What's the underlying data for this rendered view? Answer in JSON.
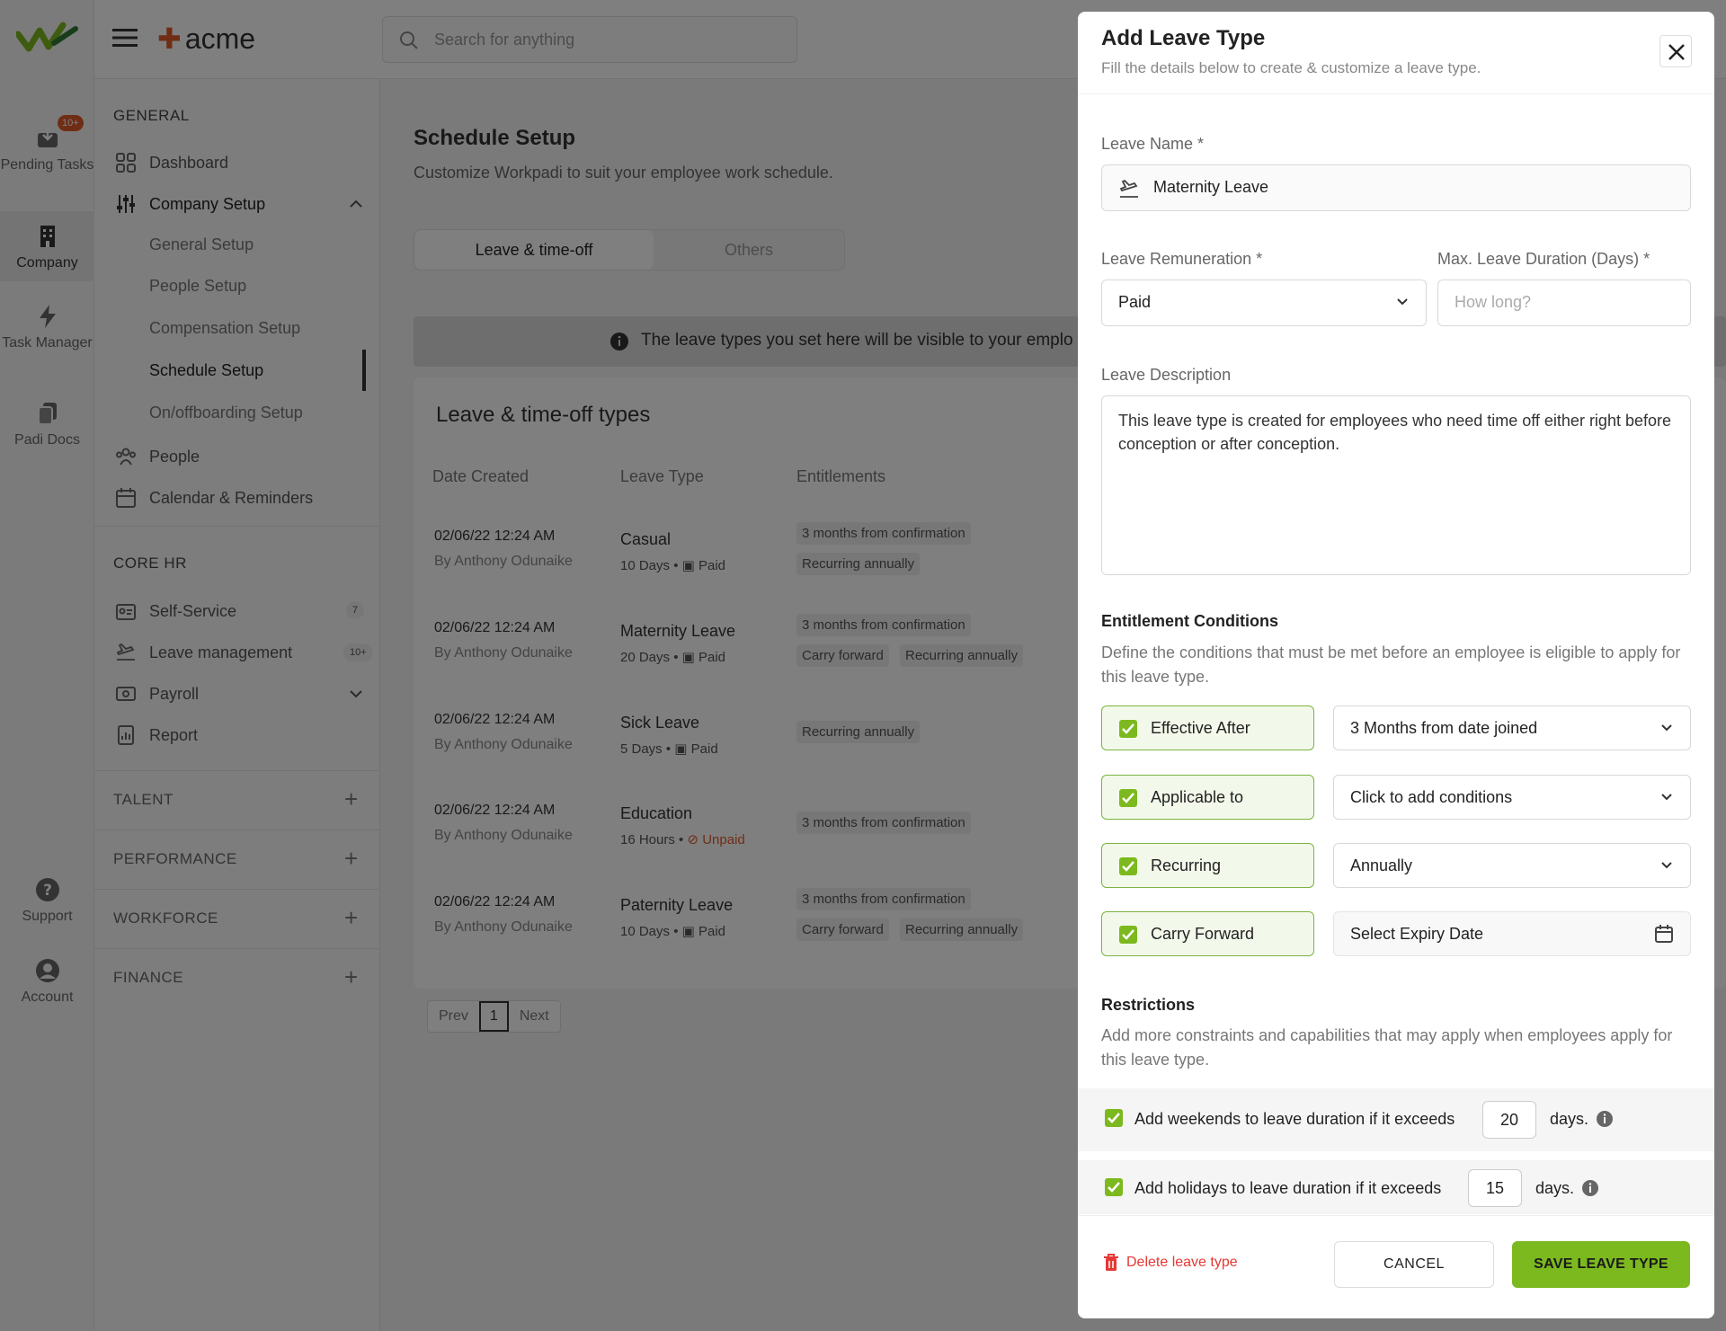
{
  "app": {
    "brand": "acme",
    "search_placeholder": "Search for anything"
  },
  "rail": {
    "pending_badge": "10+",
    "items": [
      {
        "label": "Pending Tasks"
      },
      {
        "label": "Company"
      },
      {
        "label": "Task Manager"
      },
      {
        "label": "Padi Docs"
      },
      {
        "label": "Support"
      },
      {
        "label": "Account"
      }
    ]
  },
  "sidebar": {
    "general_title": "GENERAL",
    "dashboard": "Dashboard",
    "company_setup": "Company Setup",
    "sub": [
      "General Setup",
      "People Setup",
      "Compensation Setup",
      "Schedule Setup",
      "On/offboarding Setup"
    ],
    "people": "People",
    "calendar": "Calendar & Reminders",
    "core_title": "CORE HR",
    "self_service": "Self-Service",
    "self_service_badge": "7",
    "leave_mgmt": "Leave management",
    "leave_badge": "10+",
    "payroll": "Payroll",
    "report": "Report",
    "groups": [
      "TALENT",
      "PERFORMANCE",
      "WORKFORCE",
      "FINANCE"
    ]
  },
  "main": {
    "title": "Schedule Setup",
    "subtitle": "Customize Workpadi to suit your employee work schedule.",
    "tabs": [
      "Leave & time-off",
      "Others"
    ],
    "banner": "The leave types you set here will be visible to your emplo",
    "card_title": "Leave & time-off types",
    "columns": [
      "Date Created",
      "Leave Type",
      "Entitlements"
    ],
    "rows": [
      {
        "date": "02/06/22 12:24 AM",
        "by": "By Anthony Odunaike",
        "type": "Casual",
        "meta_a": "10 Days •",
        "meta_b": "Paid",
        "chips": [
          "3 months from confirmation",
          "Recurring annually"
        ]
      },
      {
        "date": "02/06/22 12:24 AM",
        "by": "By Anthony Odunaike",
        "type": "Maternity Leave",
        "meta_a": "20 Days •",
        "meta_b": "Paid",
        "chips": [
          "3 months from confirmation",
          "Carry forward",
          "Recurring annually"
        ]
      },
      {
        "date": "02/06/22 12:24 AM",
        "by": "By Anthony Odunaike",
        "type": "Sick Leave",
        "meta_a": "5 Days •",
        "meta_b": "Paid",
        "chips": [
          "Recurring annually"
        ]
      },
      {
        "date": "02/06/22 12:24 AM",
        "by": "By Anthony Odunaike",
        "type": "Education",
        "meta_a": "16 Hours •",
        "meta_b": "Unpaid",
        "chips": [
          "3 months from confirmation"
        ]
      },
      {
        "date": "02/06/22 12:24 AM",
        "by": "By Anthony Odunaike",
        "type": "Paternity Leave",
        "meta_a": "10 Days •",
        "meta_b": "Paid",
        "chips": [
          "3 months from confirmation",
          "Carry forward",
          "Recurring annually"
        ]
      }
    ],
    "pager": {
      "prev": "Prev",
      "page": "1",
      "next": "Next"
    }
  },
  "modal": {
    "title": "Add Leave Type",
    "subtitle": "Fill the details below to create & customize a leave type.",
    "leave_name_label": "Leave Name *",
    "leave_name_value": "Maternity Leave",
    "remuneration_label": "Leave Remuneration *",
    "remuneration_value": "Paid",
    "max_duration_label": "Max. Leave Duration (Days) *",
    "max_duration_placeholder": "How long?",
    "description_label": "Leave Description",
    "description_value": "This leave type is created for employees who need time off either right before conception or after conception.",
    "entitlement_title": "Entitlement Conditions",
    "entitlement_desc": "Define the conditions that must be met before an employee is eligible to apply for this leave type.",
    "conditions": [
      {
        "label": "Effective After",
        "value": "3 Months from date joined",
        "checked": true
      },
      {
        "label": "Applicable to",
        "value": "Click to add conditions",
        "checked": true
      },
      {
        "label": "Recurring",
        "value": "Annually",
        "checked": true
      },
      {
        "label": "Carry Forward",
        "value": "Select Expiry Date",
        "checked": true
      }
    ],
    "restrictions_title": "Restrictions",
    "restrictions_desc": "Add more constraints and capabilities that may apply when employees apply for this leave type.",
    "restrictions": [
      {
        "text": "Add weekends to leave duration if it exceeds",
        "value": "20",
        "unit": "days."
      },
      {
        "text": "Add holidays to leave duration if it exceeds",
        "value": "15",
        "unit": "days."
      }
    ],
    "delete_label": "Delete leave type",
    "cancel_label": "CANCEL",
    "save_label": "SAVE LEAVE TYPE"
  },
  "colors": {
    "accent": "#7cb91e",
    "brand_orange": "#e05a2b",
    "danger": "#e53935"
  }
}
